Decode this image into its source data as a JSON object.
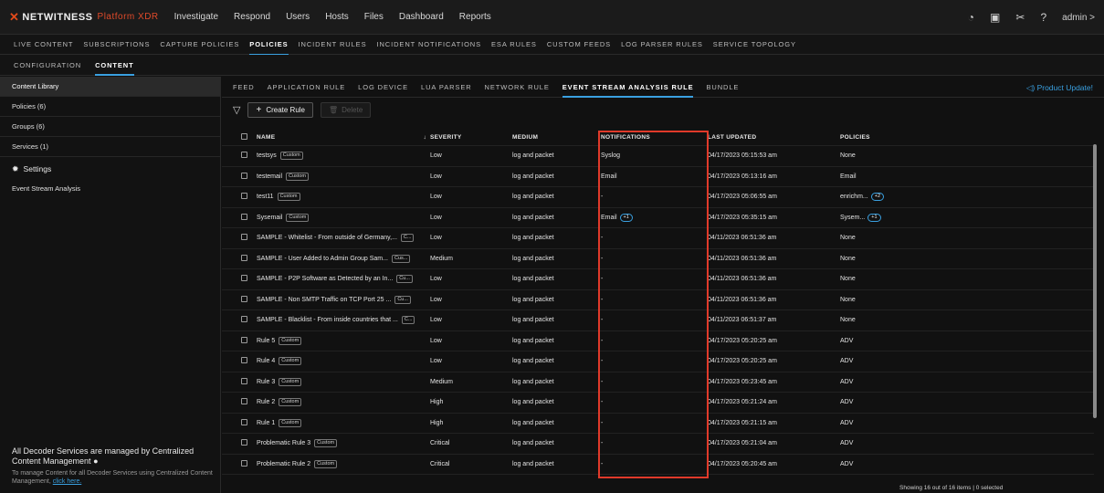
{
  "topnav": {
    "brand": "NETWITNESS",
    "platform": "Platform XDR",
    "links": [
      "Investigate",
      "Respond",
      "Users",
      "Hosts",
      "Files",
      "Dashboard",
      "Reports"
    ],
    "user": "admin >"
  },
  "subnav": {
    "items": [
      "LIVE CONTENT",
      "SUBSCRIPTIONS",
      "CAPTURE POLICIES",
      "POLICIES",
      "INCIDENT RULES",
      "INCIDENT NOTIFICATIONS",
      "ESA RULES",
      "CUSTOM FEEDS",
      "LOG PARSER RULES",
      "SERVICE TOPOLOGY"
    ],
    "active": 3
  },
  "tertnav": {
    "items": [
      "CONFIGURATION",
      "CONTENT"
    ],
    "active": 1
  },
  "sidebar": {
    "items": [
      "Content Library",
      "Policies (6)",
      "Groups (6)",
      "Services (1)"
    ],
    "settings": "Settings",
    "settings_sub": "Event Stream Analysis",
    "footer_title": "All Decoder Services are managed by Centralized Content Management",
    "footer_info": "To manage Content for all Decoder Services using Centralized Content Management,",
    "footer_link": "click here."
  },
  "main": {
    "tabs": [
      "FEED",
      "APPLICATION RULE",
      "LOG DEVICE",
      "LUA PARSER",
      "NETWORK RULE",
      "EVENT STREAM ANALYSIS RULE",
      "BUNDLE"
    ],
    "active_tab": 5,
    "product_update": "Product Update!",
    "create_rule": "Create Rule",
    "delete": "Delete"
  },
  "table": {
    "headers": {
      "name": "NAME",
      "severity": "SEVERITY",
      "medium": "MEDIUM",
      "notifications": "NOTIFICATIONS",
      "last_updated": "LAST UPDATED",
      "policies": "POLICIES"
    },
    "rows": [
      {
        "name": "testsys",
        "tag": "Custom",
        "severity": "Low",
        "medium": "log and packet",
        "notif": "Syslog",
        "notif_pill": "",
        "updated": "04/17/2023 05:15:53 am",
        "policy": "None",
        "policy_pill": ""
      },
      {
        "name": "testemail",
        "tag": "Custom",
        "severity": "Low",
        "medium": "log and packet",
        "notif": "Email",
        "notif_pill": "",
        "updated": "04/17/2023 05:13:16 am",
        "policy": "Email",
        "policy_pill": ""
      },
      {
        "name": "test11",
        "tag": "Custom",
        "severity": "Low",
        "medium": "log and packet",
        "notif": "-",
        "notif_pill": "",
        "updated": "04/17/2023 05:06:55 am",
        "policy": "enrichm...",
        "policy_pill": "+2"
      },
      {
        "name": "Sysemail",
        "tag": "Custom",
        "severity": "Low",
        "medium": "log and packet",
        "notif": "Email",
        "notif_pill": "+1",
        "updated": "04/17/2023 05:35:15 am",
        "policy": "Sysem...",
        "policy_pill": "+1"
      },
      {
        "name": "SAMPLE - Whitelist - From outside of Germany,...",
        "tag": "C...",
        "severity": "Low",
        "medium": "log and packet",
        "notif": "-",
        "notif_pill": "",
        "updated": "04/11/2023 06:51:36 am",
        "policy": "None",
        "policy_pill": ""
      },
      {
        "name": "SAMPLE - User Added to Admin Group Sam...",
        "tag": "Cus...",
        "severity": "Medium",
        "medium": "log and packet",
        "notif": "-",
        "notif_pill": "",
        "updated": "04/11/2023 06:51:36 am",
        "policy": "None",
        "policy_pill": ""
      },
      {
        "name": "SAMPLE - P2P Software as Detected by an In...",
        "tag": "Cu...",
        "severity": "Low",
        "medium": "log and packet",
        "notif": "-",
        "notif_pill": "",
        "updated": "04/11/2023 06:51:36 am",
        "policy": "None",
        "policy_pill": ""
      },
      {
        "name": "SAMPLE - Non SMTP Traffic on TCP Port 25 ...",
        "tag": "Cu...",
        "severity": "Low",
        "medium": "log and packet",
        "notif": "-",
        "notif_pill": "",
        "updated": "04/11/2023 06:51:36 am",
        "policy": "None",
        "policy_pill": ""
      },
      {
        "name": "SAMPLE - Blacklist - From inside countries that ...",
        "tag": "C...",
        "severity": "Low",
        "medium": "log and packet",
        "notif": "-",
        "notif_pill": "",
        "updated": "04/11/2023 06:51:37 am",
        "policy": "None",
        "policy_pill": ""
      },
      {
        "name": "Rule 5",
        "tag": "Custom",
        "severity": "Low",
        "medium": "log and packet",
        "notif": "-",
        "notif_pill": "",
        "updated": "04/17/2023 05:20:25 am",
        "policy": "ADV",
        "policy_pill": ""
      },
      {
        "name": "Rule 4",
        "tag": "Custom",
        "severity": "Low",
        "medium": "log and packet",
        "notif": "-",
        "notif_pill": "",
        "updated": "04/17/2023 05:20:25 am",
        "policy": "ADV",
        "policy_pill": ""
      },
      {
        "name": "Rule 3",
        "tag": "Custom",
        "severity": "Medium",
        "medium": "log and packet",
        "notif": "-",
        "notif_pill": "",
        "updated": "04/17/2023 05:23:45 am",
        "policy": "ADV",
        "policy_pill": ""
      },
      {
        "name": "Rule 2",
        "tag": "Custom",
        "severity": "High",
        "medium": "log and packet",
        "notif": "-",
        "notif_pill": "",
        "updated": "04/17/2023 05:21:24 am",
        "policy": "ADV",
        "policy_pill": ""
      },
      {
        "name": "Rule 1",
        "tag": "Custom",
        "severity": "High",
        "medium": "log and packet",
        "notif": "-",
        "notif_pill": "",
        "updated": "04/17/2023 05:21:15 am",
        "policy": "ADV",
        "policy_pill": ""
      },
      {
        "name": "Problematic Rule 3",
        "tag": "Custom",
        "severity": "Critical",
        "medium": "log and packet",
        "notif": "-",
        "notif_pill": "",
        "updated": "04/17/2023 05:21:04 am",
        "policy": "ADV",
        "policy_pill": ""
      },
      {
        "name": "Problematic Rule 2",
        "tag": "Custom",
        "severity": "Critical",
        "medium": "log and packet",
        "notif": "-",
        "notif_pill": "",
        "updated": "04/17/2023 05:20:45 am",
        "policy": "ADV",
        "policy_pill": ""
      }
    ]
  },
  "status": "Showing 16 out of 16 items | 0 selected",
  "colors": {
    "accent": "#3aa0e0",
    "highlight": "#e03a2a",
    "brand": "#e24a1a"
  }
}
